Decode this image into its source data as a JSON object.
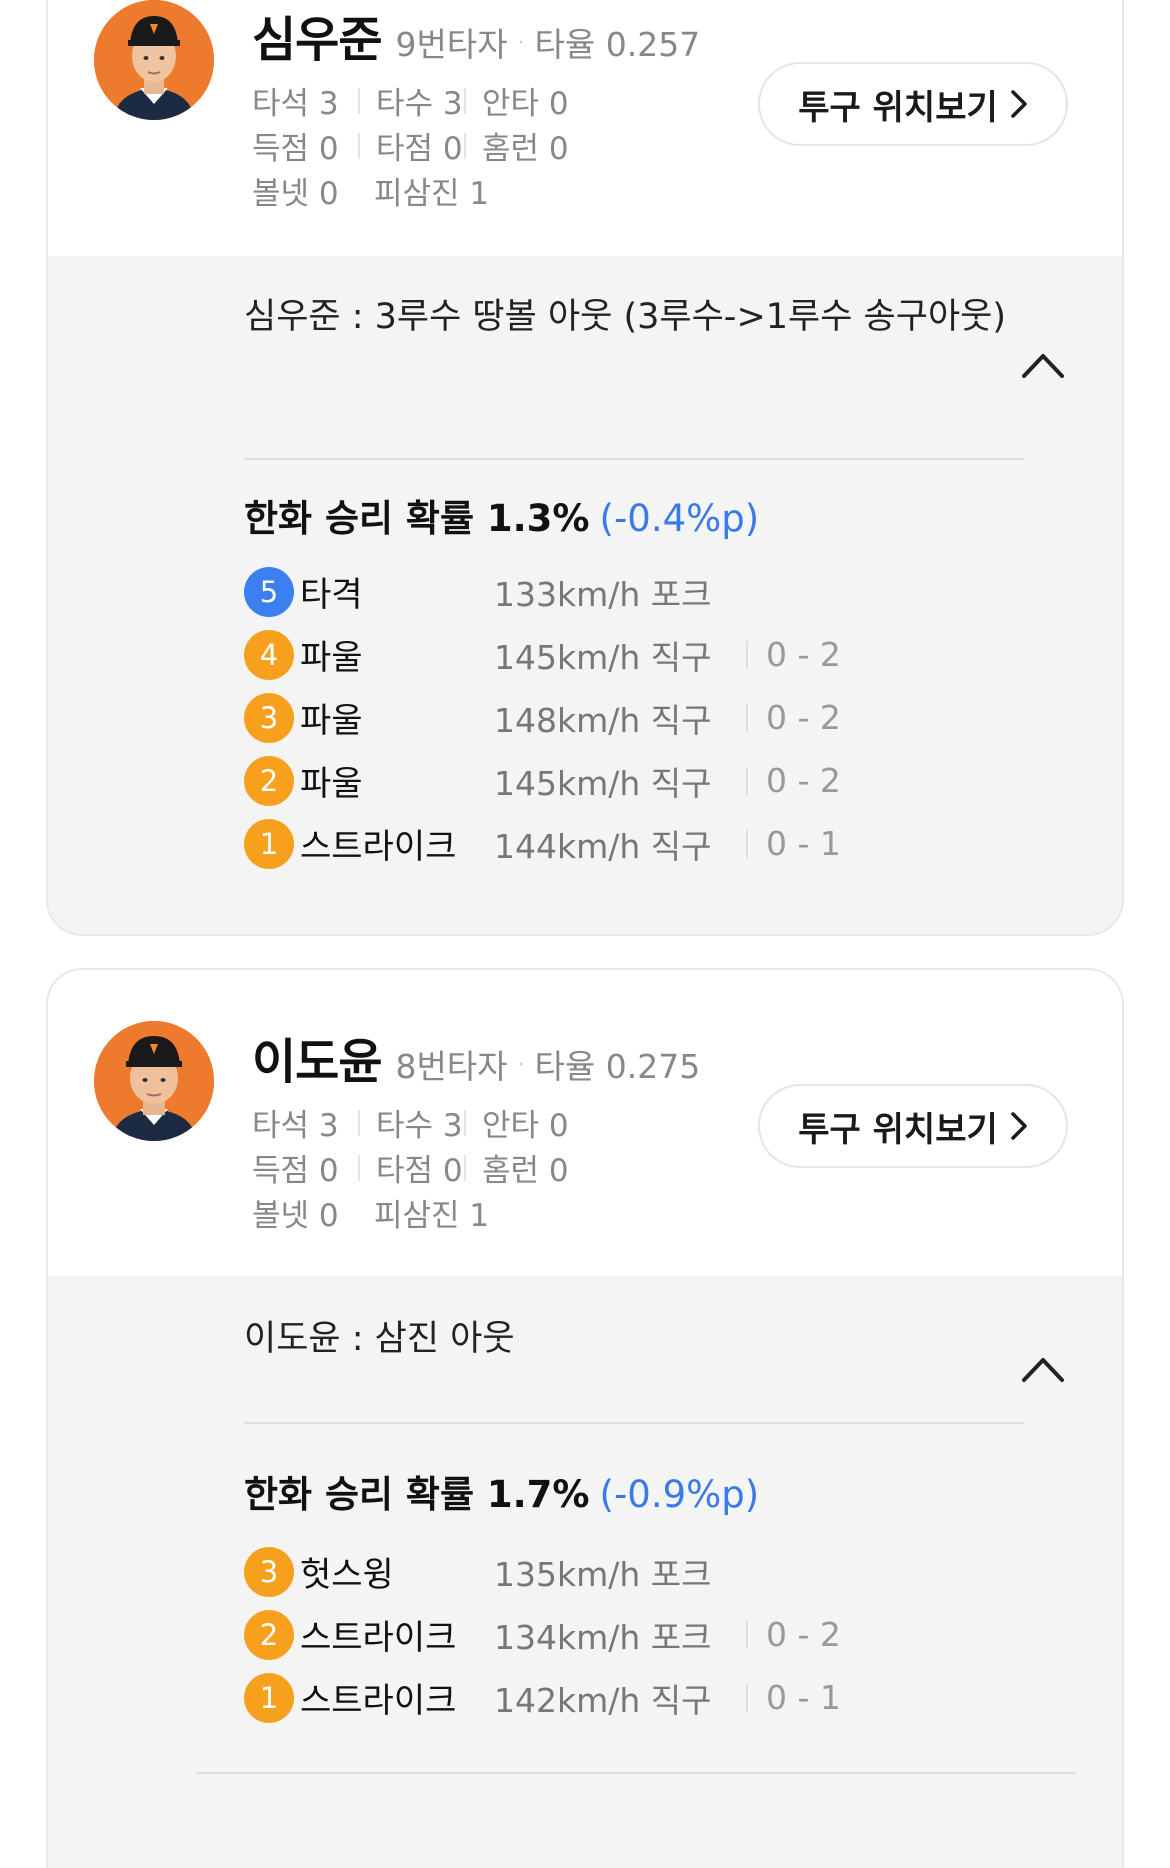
{
  "players": [
    {
      "name": "심우준",
      "order": "9번타자",
      "sep": "·",
      "avg": "타율 0.257",
      "stats": [
        [
          "타석 3",
          "타수 3",
          "안타 0"
        ],
        [
          "득점 0",
          "타점 0",
          "홈런 0"
        ],
        [
          "볼넷 0",
          "피삼진 1"
        ]
      ],
      "button_label": "투구 위치보기",
      "play": "심우준 : 3루수 땅볼 아웃 (3루수->1루수 송구아웃)",
      "win_prob": "한화 승리 확률 1.3%",
      "win_delta": "(-0.4%p)",
      "pitches": [
        {
          "num": "5",
          "result": "타격",
          "speed": "133km/h 포크",
          "count": "",
          "color": "blue"
        },
        {
          "num": "4",
          "result": "파울",
          "speed": "145km/h 직구",
          "count": "0 - 2",
          "color": "orange"
        },
        {
          "num": "3",
          "result": "파울",
          "speed": "148km/h 직구",
          "count": "0 - 2",
          "color": "orange"
        },
        {
          "num": "2",
          "result": "파울",
          "speed": "145km/h 직구",
          "count": "0 - 2",
          "color": "orange"
        },
        {
          "num": "1",
          "result": "스트라이크",
          "speed": "144km/h 직구",
          "count": "0 - 1",
          "color": "orange"
        }
      ]
    },
    {
      "name": "이도윤",
      "order": "8번타자",
      "sep": "·",
      "avg": "타율 0.275",
      "stats": [
        [
          "타석 3",
          "타수 3",
          "안타 0"
        ],
        [
          "득점 0",
          "타점 0",
          "홈런 0"
        ],
        [
          "볼넷 0",
          "피삼진 1"
        ]
      ],
      "button_label": "투구 위치보기",
      "play": "이도윤 : 삼진 아웃",
      "win_prob": "한화 승리 확률 1.7%",
      "win_delta": "(-0.9%p)",
      "pitches": [
        {
          "num": "3",
          "result": "헛스윙",
          "speed": "135km/h 포크",
          "count": "",
          "color": "orange"
        },
        {
          "num": "2",
          "result": "스트라이크",
          "speed": "134km/h 포크",
          "count": "0 - 2",
          "color": "orange"
        },
        {
          "num": "1",
          "result": "스트라이크",
          "speed": "142km/h 직구",
          "count": "0 - 1",
          "color": "orange"
        }
      ]
    }
  ],
  "icons": {
    "button_chevron": "chevron-right-icon",
    "collapse": "chevron-up-icon",
    "avatar": "player-photo"
  },
  "colors": {
    "pitch_orange": "#f7a01e",
    "pitch_blue": "#3b7ff1",
    "delta_blue": "#3a7ae8",
    "avatar_bg": "#ee7a2d"
  }
}
